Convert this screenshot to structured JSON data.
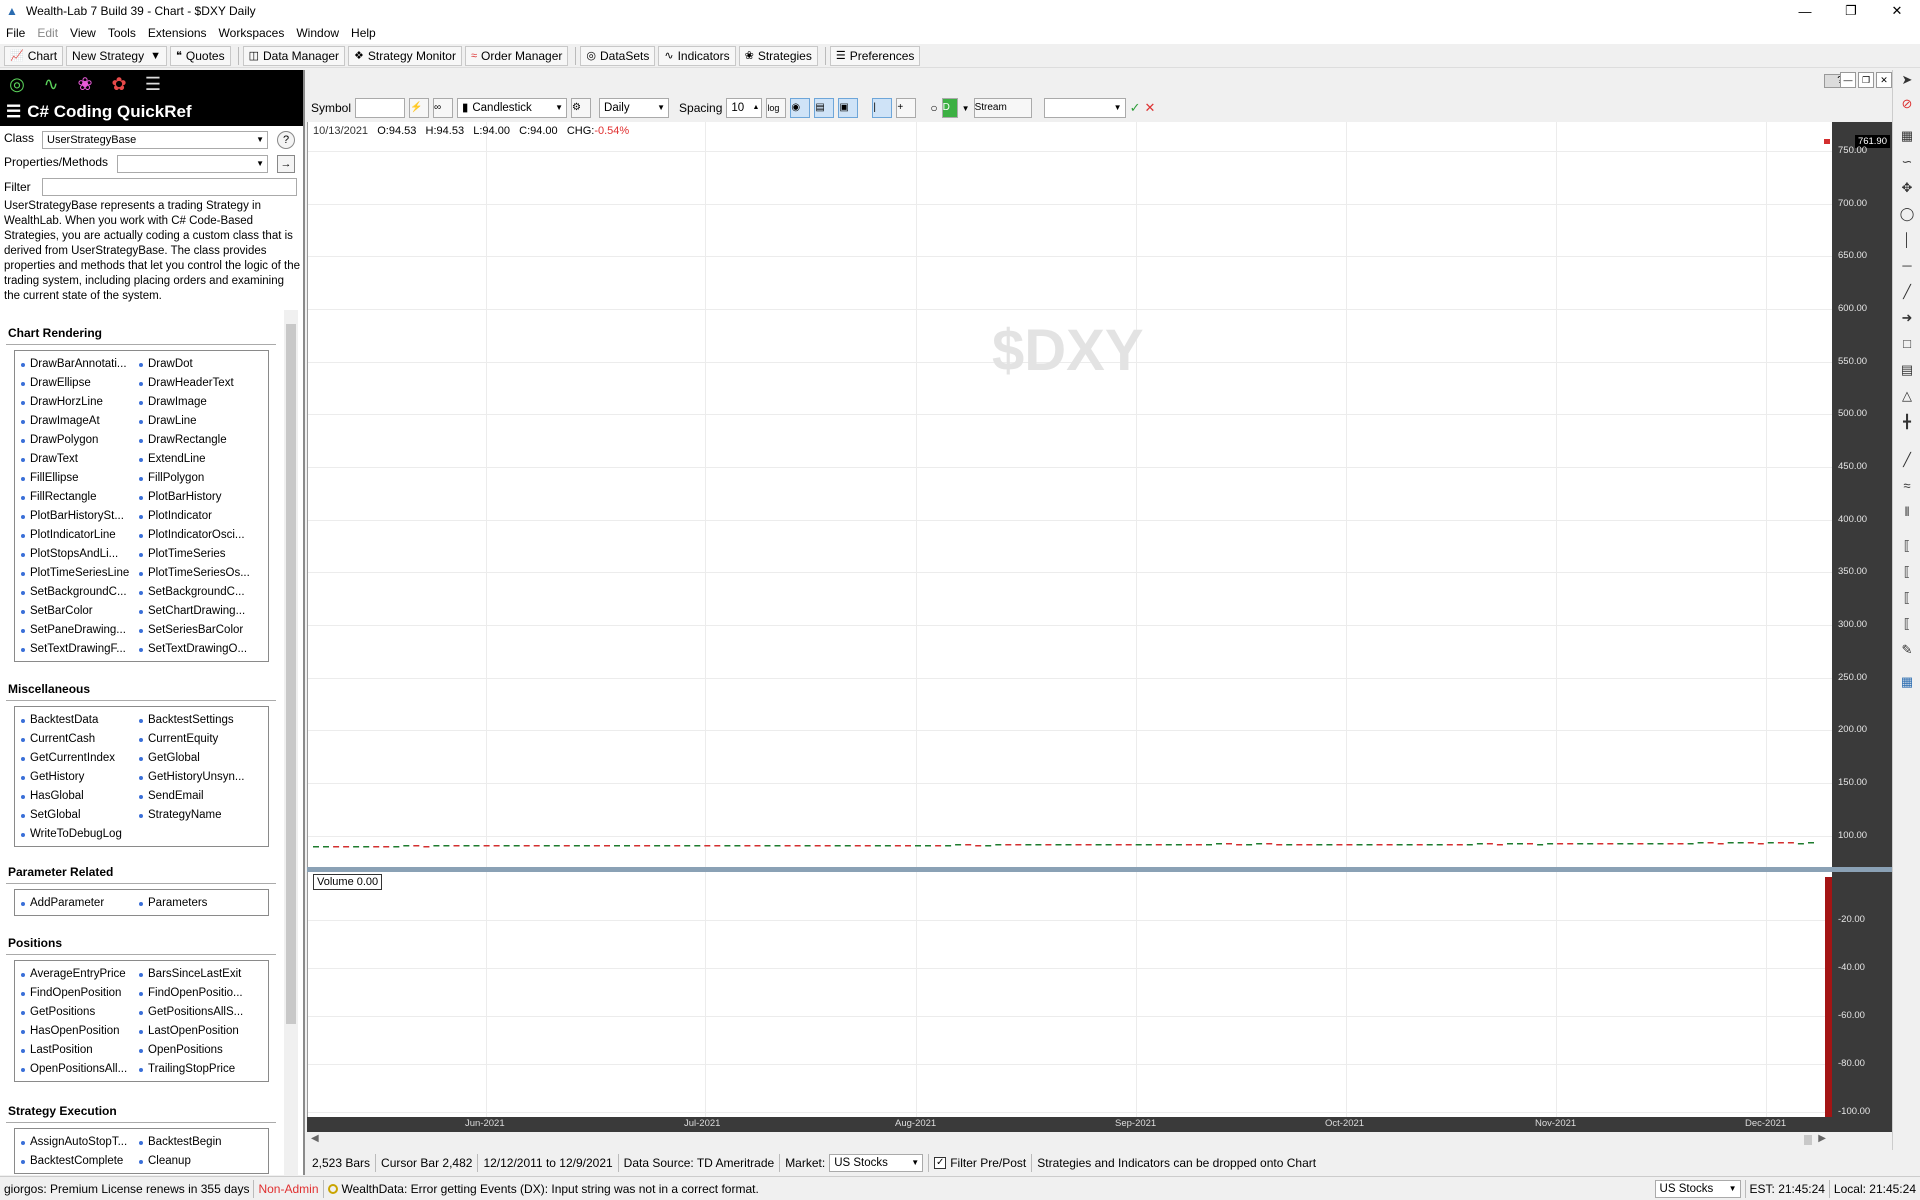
{
  "window": {
    "title": "Wealth-Lab 7 Build 39 - Chart - $DXY Daily"
  },
  "menu": [
    "File",
    "Edit",
    "View",
    "Tools",
    "Extensions",
    "Workspaces",
    "Window",
    "Help"
  ],
  "toolbar": {
    "chart": "Chart",
    "new_strategy": "New Strategy",
    "quotes": "Quotes",
    "data_manager": "Data Manager",
    "strategy_monitor": "Strategy Monitor",
    "order_manager": "Order Manager",
    "datasets": "DataSets",
    "indicators": "Indicators",
    "strategies": "Strategies",
    "preferences": "Preferences"
  },
  "quickref": {
    "title": "C# Coding QuickRef",
    "class_label": "Class",
    "class_value": "UserStrategyBase",
    "props_label": "Properties/Methods",
    "props_value": "",
    "filter_label": "Filter",
    "filter_value": "",
    "description": "UserStrategyBase represents a trading Strategy in WealthLab. When you work with C# Code-Based Strategies, you are actually coding a custom class that is derived from UserStrategyBase. The class provides properties and methods that let you control the logic of the trading system, including placing orders and examining the current state of the system.",
    "sections": [
      {
        "title": "Chart Rendering",
        "items": [
          "DrawBarAnnotati...",
          "DrawDot",
          "DrawEllipse",
          "DrawHeaderText",
          "DrawHorzLine",
          "DrawImage",
          "DrawImageAt",
          "DrawLine",
          "DrawPolygon",
          "DrawRectangle",
          "DrawText",
          "ExtendLine",
          "FillEllipse",
          "FillPolygon",
          "FillRectangle",
          "PlotBarHistory",
          "PlotBarHistorySt...",
          "PlotIndicator",
          "PlotIndicatorLine",
          "PlotIndicatorOsci...",
          "PlotStopsAndLi...",
          "PlotTimeSeries",
          "PlotTimeSeriesLine",
          "PlotTimeSeriesOs...",
          "SetBackgroundC...",
          "SetBackgroundC...",
          "SetBarColor",
          "SetChartDrawing...",
          "SetPaneDrawing...",
          "SetSeriesBarColor",
          "SetTextDrawingF...",
          "SetTextDrawingO..."
        ]
      },
      {
        "title": "Miscellaneous",
        "items": [
          "BacktestData",
          "BacktestSettings",
          "CurrentCash",
          "CurrentEquity",
          "GetCurrentIndex",
          "GetGlobal",
          "GetHistory",
          "GetHistoryUnsyn...",
          "HasGlobal",
          "SendEmail",
          "SetGlobal",
          "StrategyName",
          "WriteToDebugLog"
        ]
      },
      {
        "title": "Parameter Related",
        "items": [
          "AddParameter",
          "Parameters"
        ]
      },
      {
        "title": "Positions",
        "items": [
          "AverageEntryPrice",
          "BarsSinceLastExit",
          "FindOpenPosition",
          "FindOpenPositio...",
          "GetPositions",
          "GetPositionsAllS...",
          "HasOpenPosition",
          "LastOpenPosition",
          "LastPosition",
          "OpenPositions",
          "OpenPositionsAll...",
          "TrailingStopPrice"
        ]
      },
      {
        "title": "Strategy Execution",
        "items": [
          "AssignAutoStopT...",
          "BacktestBegin",
          "BacktestComplete",
          "Cleanup"
        ]
      }
    ]
  },
  "chart_toolbar": {
    "symbol_label": "Symbol",
    "symbol_value": "",
    "chart_style": "Candlestick",
    "scale": "Daily",
    "spacing_label": "Spacing",
    "spacing_value": "10",
    "log_label": "log",
    "stream": "Stream",
    "stream_value": ""
  },
  "chart": {
    "watermark": "$DXY",
    "ohlc": {
      "date": "10/13/2021",
      "o": "O:94.53",
      "h": "H:94.53",
      "l": "L:94.00",
      "c": "C:94.00",
      "chg_label": "CHG:",
      "chg": "-0.54%"
    },
    "last_price": "761.90",
    "volume_label": "Volume 0.00",
    "up_color": "#1e7b2e",
    "down_color": "#d32f2f"
  },
  "chart_data": [
    {
      "type": "candlestick",
      "series": [
        {
          "name": "$DXY",
          "x_range": [
            "2021-05",
            "2021-12"
          ],
          "y_approx": [
            90,
            96
          ]
        }
      ],
      "y_ticks": [
        750,
        700,
        650,
        600,
        550,
        500,
        450,
        400,
        350,
        300,
        250,
        200,
        150,
        100
      ],
      "x_ticks": [
        "Jun-2021",
        "Jul-2021",
        "Aug-2021",
        "Sep-2021",
        "Oct-2021",
        "Nov-2021",
        "Dec-2021"
      ],
      "ylim": [
        75,
        770
      ]
    },
    {
      "type": "bar",
      "series": [
        {
          "name": "Volume",
          "values": [
            0
          ]
        }
      ],
      "y_ticks": [
        -20.0,
        -40.0,
        -60.0,
        -80.0,
        -100.0
      ]
    }
  ],
  "price_ticks": [
    "750.00",
    "700.00",
    "650.00",
    "600.00",
    "550.00",
    "500.00",
    "450.00",
    "400.00",
    "350.00",
    "300.00",
    "250.00",
    "200.00",
    "150.00",
    "100.00"
  ],
  "vol_ticks": [
    "-20.00",
    "-40.00",
    "-60.00",
    "-80.00",
    "-100.00"
  ],
  "date_ticks": [
    "Jun-2021",
    "Jul-2021",
    "Aug-2021",
    "Sep-2021",
    "Oct-2021",
    "Nov-2021",
    "Dec-2021"
  ],
  "status": {
    "bars": "2,523 Bars",
    "cursor": "Cursor Bar 2,482",
    "range": "12/12/2011 to 12/9/2021",
    "datasource": "Data Source: TD Ameritrade",
    "market_label": "Market:",
    "market_value": "US Stocks",
    "filter": "Filter Pre/Post",
    "hint": "Strategies and Indicators can be dropped onto Chart",
    "license": "giorgos: Premium License renews in 355 days",
    "admin": "Non-Admin",
    "error": "WealthData: Error getting Events (DX): Input string was not in a correct format.",
    "market2": "US Stocks",
    "est": "EST: 21:45:24",
    "local": "Local: 21:45:24"
  }
}
